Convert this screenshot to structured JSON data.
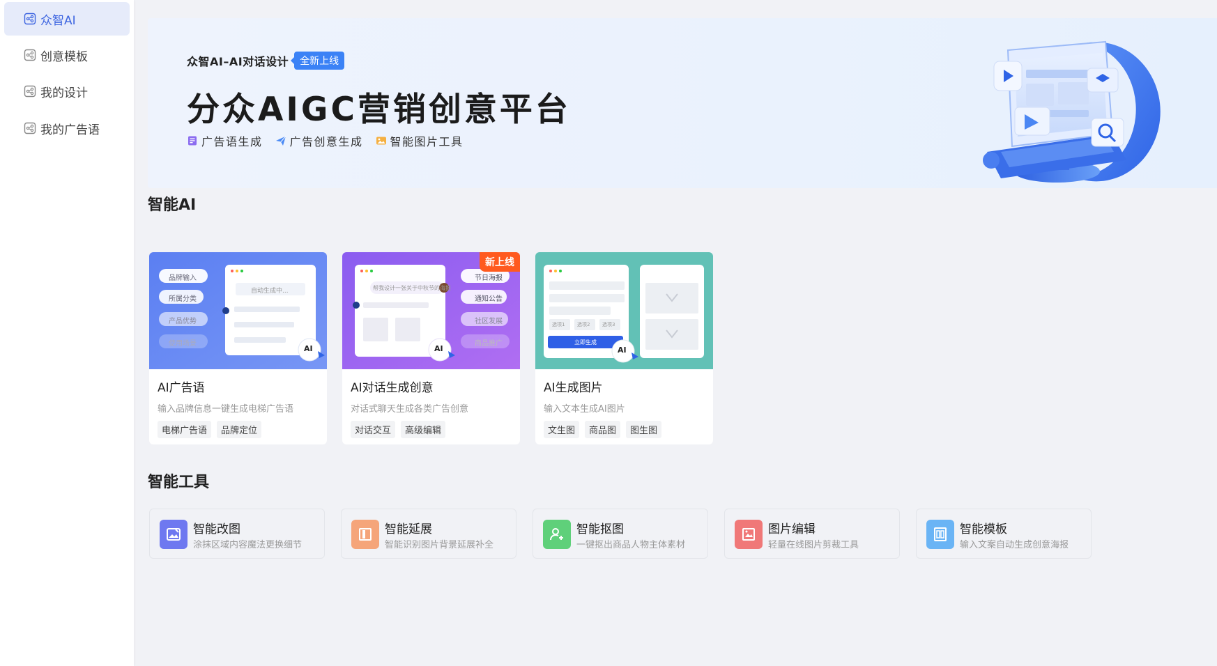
{
  "sidebar": {
    "items": [
      {
        "label": "众智AI",
        "active": true
      },
      {
        "label": "创意模板",
        "active": false
      },
      {
        "label": "我的设计",
        "active": false
      },
      {
        "label": "我的广告语",
        "active": false
      }
    ]
  },
  "banner": {
    "pretitle": "众智AI–AI对话设计",
    "badge": "全新上线",
    "title": "分众AIGC营销创意平台",
    "features": [
      {
        "label": "广告语生成",
        "icon": "document-icon"
      },
      {
        "label": "广告创意生成",
        "icon": "paper-plane-icon"
      },
      {
        "label": "智能图片工具",
        "icon": "image-icon"
      }
    ]
  },
  "sections": {
    "ai_title": "智能AI",
    "tools_title": "智能工具"
  },
  "ai_cards": [
    {
      "title": "AI广告语",
      "desc": "输入品牌信息一键生成电梯广告语",
      "tags": [
        "电梯广告语",
        "品牌定位"
      ],
      "thumb": {
        "chips": [
          "品牌输入",
          "所属分类",
          "产品优势",
          "使用场景"
        ],
        "input": "自动生成中...",
        "ai": "AI"
      },
      "color": "#5b7cf0"
    },
    {
      "title": "AI对话生成创意",
      "desc": "对话式聊天生成各类广告创意",
      "tags": [
        "对话交互",
        "高级编辑"
      ],
      "badge": "新上线",
      "thumb": {
        "chips": [
          "节日海报",
          "通知公告",
          "社区发展",
          "商品推广"
        ],
        "input": "帮我设计一张关于中秋节的海报",
        "ai": "AI"
      },
      "color": "#9a5cf0"
    },
    {
      "title": "AI生成图片",
      "desc": "输入文本生成AI图片",
      "tags": [
        "文生图",
        "商品图",
        "图生图"
      ],
      "thumb": {
        "chips": [
          "选项1",
          "选项2",
          "选项3"
        ],
        "button": "立即生成",
        "ai": "AI"
      },
      "color": "#5fc0b6"
    }
  ],
  "tools": [
    {
      "title": "智能改图",
      "desc": "涂抹区域内容魔法更换细节",
      "icon": "edit-image-icon",
      "color": "#6e78f0"
    },
    {
      "title": "智能延展",
      "desc": "智能识别图片背景延展补全",
      "icon": "expand-icon",
      "color": "#f5a57a"
    },
    {
      "title": "智能抠图",
      "desc": "一键抠出商品人物主体素材",
      "icon": "add-person-icon",
      "color": "#5fd07a"
    },
    {
      "title": "图片编辑",
      "desc": "轻量在线图片剪裁工具",
      "icon": "crop-image-icon",
      "color": "#f07878"
    },
    {
      "title": "智能模板",
      "desc": "输入文案自动生成创意海报",
      "icon": "template-icon",
      "color": "#6ab4f5"
    }
  ]
}
